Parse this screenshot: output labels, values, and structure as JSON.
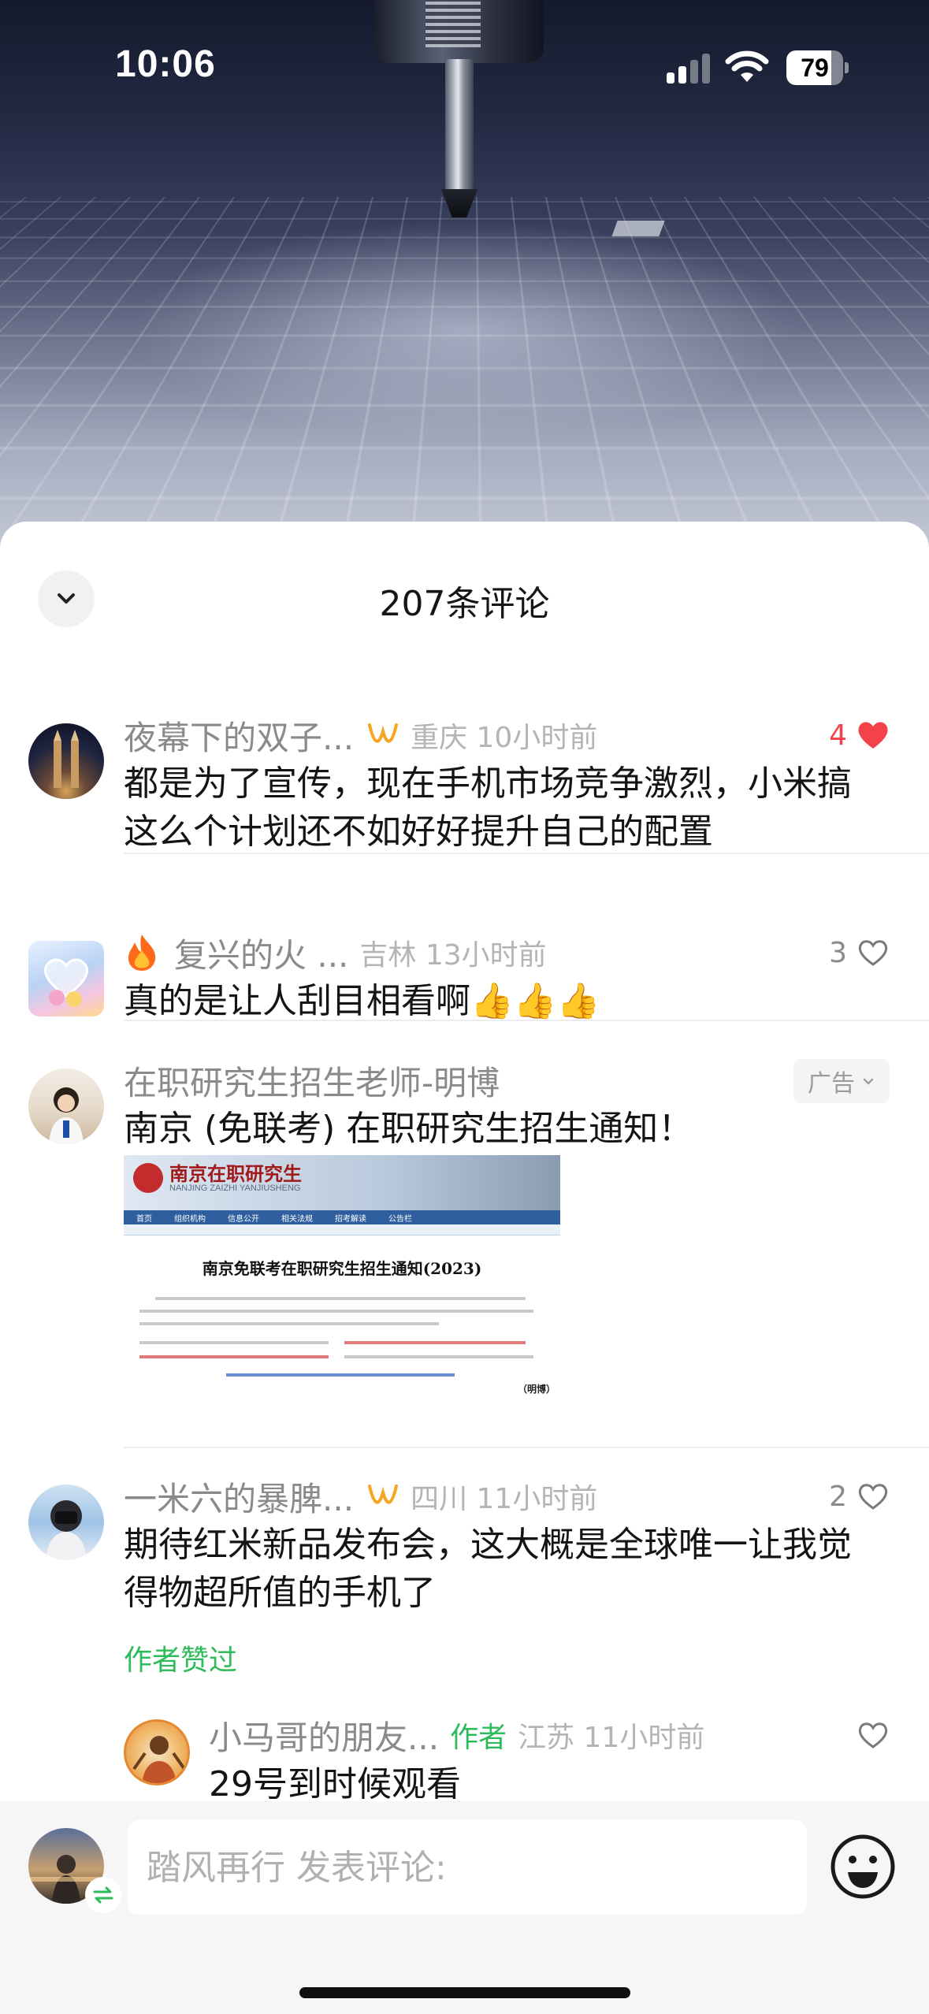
{
  "status_bar": {
    "time": "10:06",
    "battery_level": "79",
    "battery_fraction": 0.79
  },
  "sheet": {
    "title": "207条评论"
  },
  "comments": [
    {
      "username": "夜幕下的双子...",
      "location_time": "重庆 10小时前",
      "text": "都是为了宣传，现在手机市场竞争激烈，小米搞这么个计划还不如好好提升自己的配置",
      "likes": "4",
      "liked": true
    },
    {
      "username": "复兴的火 ...",
      "location_time": "吉林 13小时前",
      "text": "真的是让人刮目相看啊👍👍👍",
      "likes": "3",
      "liked": false
    },
    {
      "username": "一米六的暴脾...",
      "location_time": "四川 11小时前",
      "text": "期待红米新品发布会，这大概是全球唯一让我觉得物超所值的手机了",
      "likes": "2",
      "liked": false,
      "author_liked_label": "作者赞过"
    }
  ],
  "ad": {
    "username": "在职研究生招生老师-明博",
    "tag": "广告",
    "text": "南京 (免联考) 在职研究生招生通知！",
    "image": {
      "banner_title": "南京在职研究生",
      "banner_subtitle": "NANJING ZAIZHI YANJIUSHENG",
      "nav": [
        "首页",
        "组织机构",
        "信息公开",
        "相关法规",
        "招考解读",
        "公告栏"
      ],
      "headline": "南京免联考在职研究生招生通知(2023)",
      "signature": "（明博）"
    }
  },
  "reply": {
    "username": "小马哥的朋友...",
    "author_tag": "作者",
    "location_time": "江苏 11小时前",
    "text": "29号到时候观看"
  },
  "input": {
    "placeholder": "踏风再行 发表评论:"
  },
  "icons": {
    "collapse": "chevron-down-icon",
    "like": "heart-icon",
    "emoji": "smiley-icon",
    "fan_badge": "fan-badge-icon",
    "switch": "switch-account-icon"
  },
  "colors": {
    "like_active": "#f3424a",
    "author_green": "#2dbb5c",
    "fan_badge": "#f5a623"
  }
}
